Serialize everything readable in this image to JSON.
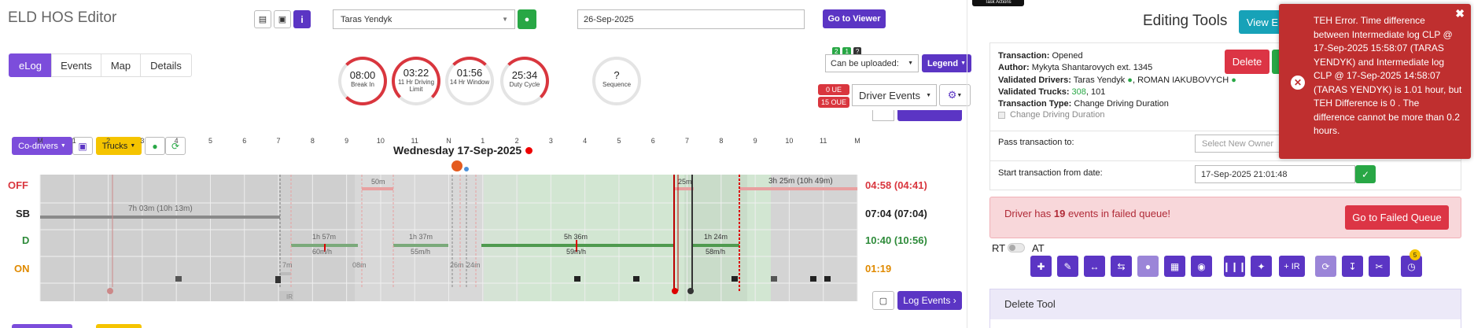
{
  "header": {
    "title": "ELD HOS Editor",
    "driver_select": "Taras Yendyk",
    "date_input": "26-Sep-2025",
    "go_to_viewer": "Go to Viewer",
    "tooltip_fragment": "Task Actions"
  },
  "tabs": [
    "eLog",
    "Events",
    "Map",
    "Details"
  ],
  "gauges": [
    {
      "value": "08:00",
      "label": "Break In"
    },
    {
      "value": "03:22",
      "label": "11 Hr Driving Limit"
    },
    {
      "value": "01:56",
      "label": "14 Hr Window"
    },
    {
      "value": "25:34",
      "label": "Duty Cycle"
    },
    {
      "value": "?",
      "label": "Sequence"
    }
  ],
  "upload": {
    "status": "Can be uploaded:",
    "badge_green_count": "2",
    "badge_truck_count": "1",
    "badge_question": "?",
    "legend": "Legend",
    "ue_badge": "0 UE",
    "oue_badge": "15 OUE",
    "driver_events": "Driver Events"
  },
  "log": {
    "co_drivers": "Co-drivers",
    "trucks": "Trucks",
    "date_title": "Wednesday 17-Sep-2025",
    "hours": [
      "M",
      "1",
      "2",
      "3",
      "4",
      "5",
      "6",
      "7",
      "8",
      "9",
      "10",
      "11",
      "N",
      "1",
      "2",
      "3",
      "4",
      "5",
      "6",
      "7",
      "8",
      "9",
      "10",
      "11",
      "M"
    ],
    "rows": [
      {
        "label": "OFF",
        "total": "04:58 (04:41)",
        "color": "#d9363e"
      },
      {
        "label": "SB",
        "total": "07:04 (07:04)",
        "color": "#222222"
      },
      {
        "label": "D",
        "total": "10:40 (10:56)",
        "color": "#2e8b3a"
      },
      {
        "label": "ON",
        "total": "01:19",
        "color": "#e08a00"
      }
    ],
    "segment_labels": {
      "sb_dur": "7h 03m (10h 13m)",
      "off_dur": "3h 25m (10h 49m)",
      "off_small": "25m",
      "off_small2": "50m",
      "d1": "1h 57m",
      "d1_speed": "60m/h",
      "d2": "1h 37m",
      "d2_speed": "55m/h",
      "d3": "5h 36m",
      "d3_speed": "59m/h",
      "d4": "1h 24m",
      "d4_speed": "58m/h",
      "on1": "7m",
      "on2": "08m",
      "on3": "26m",
      "on4": "24m",
      "ir": "IR"
    },
    "log_events": "Log Events"
  },
  "editing": {
    "title": "Editing Tools",
    "view_button": "View E",
    "delete_button": "Delete",
    "transaction_label": "Transaction:",
    "transaction_value": "Opened",
    "author_label": "Author:",
    "author_value": "Mykyta Shantarovych ext. 1345",
    "validated_drivers_label": "Validated Drivers:",
    "validated_drivers_value1": "Taras Yendyk",
    "validated_drivers_value2": "ROMAN IAKUBOVYCH",
    "validated_trucks_label": "Validated Trucks:",
    "validated_trucks_green": "308",
    "validated_trucks_rest": ", 101",
    "transaction_type_label": "Transaction Type:",
    "transaction_type_value": "Change Driving Duration",
    "checkbox_label": "Change Driving Duration",
    "pass_label": "Pass transaction to:",
    "pass_placeholder": "Select New Owner",
    "start_label": "Start transaction from date:",
    "start_value": "17-Sep-2025 21:01:48",
    "failed_prefix": "Driver has ",
    "failed_count": "19",
    "failed_suffix": " events in failed queue!",
    "failed_button": "Go to Failed Queue",
    "rt": "RT",
    "at": "AT",
    "ir_button": "+ IR",
    "badge_count": "5",
    "delete_tool": "Delete Tool"
  },
  "error_toast": {
    "message": "TEH Error. Time difference between Intermediate log CLP @ 17-Sep-2025 15:58:07 (TARAS YENDYK) and Intermediate log CLP @ 17-Sep-2025 14:58:07 (TARAS YENDYK) is 1.01 hour, but TEH Difference is 0 . The difference cannot be more than 0.2 hours."
  }
}
